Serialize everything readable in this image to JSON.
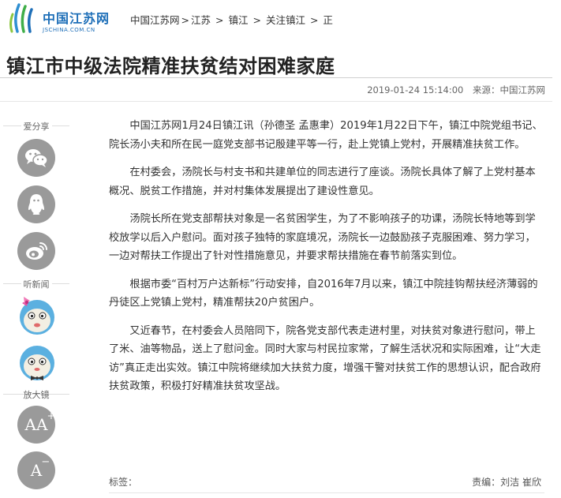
{
  "brand": {
    "name_cn": "中国江苏网",
    "name_en": "JSCHINA.COM.CN",
    "color": "#1e6fb8"
  },
  "breadcrumb": {
    "items": [
      "中国江苏网",
      "江苏",
      "镇江",
      "关注镇江",
      "正"
    ],
    "separators": [
      ">",
      ">",
      ">",
      ">"
    ]
  },
  "article": {
    "title": "镇江市中级法院精准扶贫结对困难家庭",
    "datetime": "2019-01-24 15:14:00",
    "source": "来源：中国江苏网",
    "paragraphs": [
      "中国江苏网1月24日镇江讯（孙德圣 孟惠聿）2019年1月22日下午，镇江中院党组书记、院长汤小夫和所在民一庭党支部书记殷建平等一行，赴上党镇上党村，开展精准扶贫工作。",
      "在村委会，汤院长与村支书和共建单位的同志进行了座谈。汤院长具体了解了上党村基本概况、脱贫工作措施，并对村集体发展提出了建设性意见。",
      "汤院长所在党支部帮扶对象是一名贫困学生，为了不影响孩子的功课，汤院长特地等到学校放学以后入户慰问。面对孩子独特的家庭境况，汤院长一边鼓励孩子克服困难、努力学习，一边对帮扶工作提出了针对性措施意见，并要求帮扶措施在春节前落实到位。",
      "根据市委“百村万户达新标”行动安排，自2016年7月以来，镇江中院挂钩帮扶经济薄弱的丹徒区上党镇上党村，精准帮扶20户贫困户。",
      "又近春节，在村委会人员陪同下，院各党支部代表走进村里，对扶贫对象进行慰问，带上了米、油等物品，送上了慰问金。同时大家与村民拉家常，了解生活状况和实际困难，让“大走访”真正走出实效。镇江中院将继续加大扶贫力度，增强干警对扶贫工作的思想认识，配合政府扶贫政策，积极打好精准扶贫攻坚战。"
    ],
    "tags_label": "标签：",
    "editor": "责编：刘洁 崔欣"
  },
  "sidebar": {
    "share_title": "爱分享",
    "share_buttons": [
      "wechat-icon",
      "qq-icon",
      "weibo-icon"
    ],
    "listen_title": "听新闻",
    "zoom_title": "放大镜",
    "zoom_in_label": "A",
    "zoom_in_sup": "+",
    "zoom_out_label": "A",
    "zoom_out_sup": "−",
    "button_color": "#9a9a9a"
  }
}
